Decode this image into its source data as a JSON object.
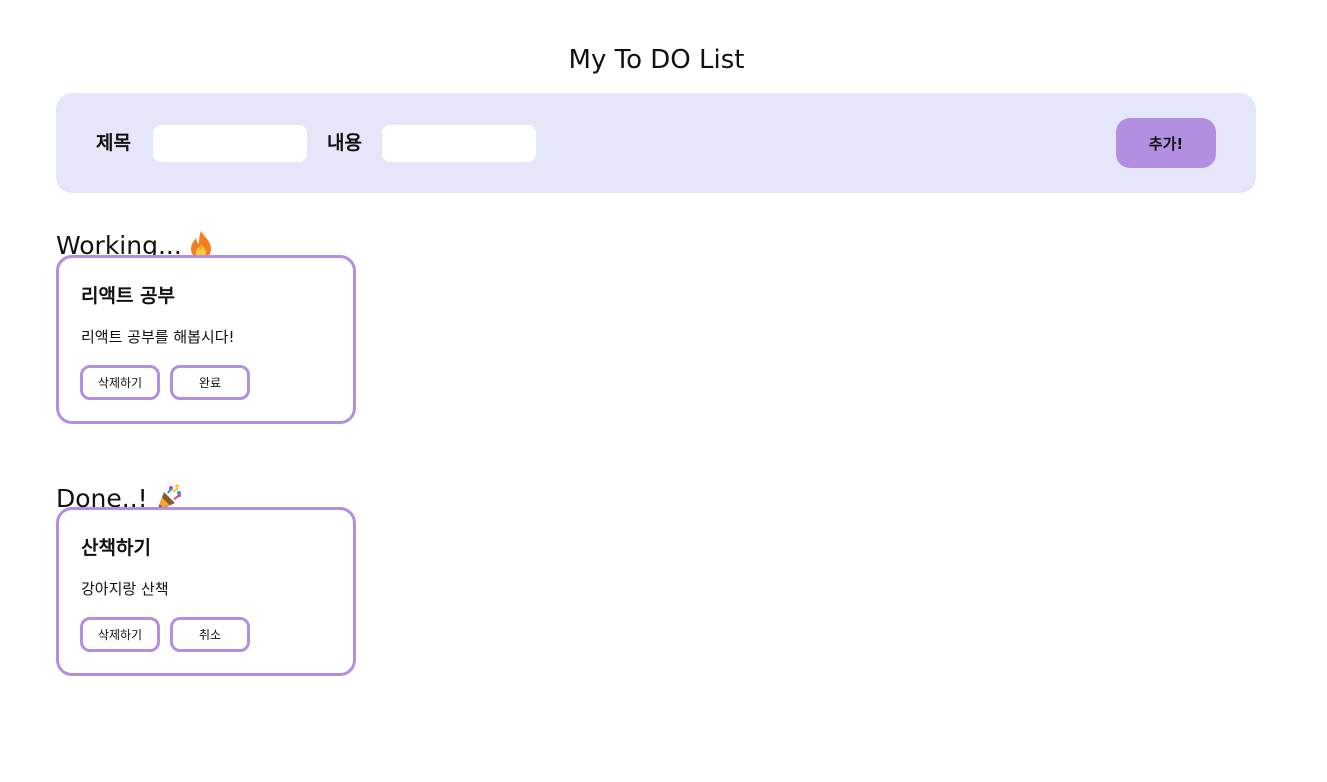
{
  "header": {
    "title": "My To DO List"
  },
  "form": {
    "title_label": "제목",
    "title_value": "",
    "content_label": "내용",
    "content_value": "",
    "add_label": "추가!"
  },
  "working": {
    "heading": "Working...",
    "emoji_icon": "fire-icon",
    "cards": [
      {
        "title": "리액트 공부",
        "body": "리액트 공부를 해봅시다!",
        "delete_label": "삭제하기",
        "toggle_label": "완료"
      }
    ]
  },
  "done": {
    "heading": "Done..!",
    "emoji_icon": "party-popper-icon",
    "cards": [
      {
        "title": "산책하기",
        "body": "강아지랑 산책",
        "delete_label": "삭제하기",
        "toggle_label": "취소"
      }
    ]
  },
  "colors": {
    "accent": "#b28fe0",
    "panel": "#e6e6fa"
  }
}
